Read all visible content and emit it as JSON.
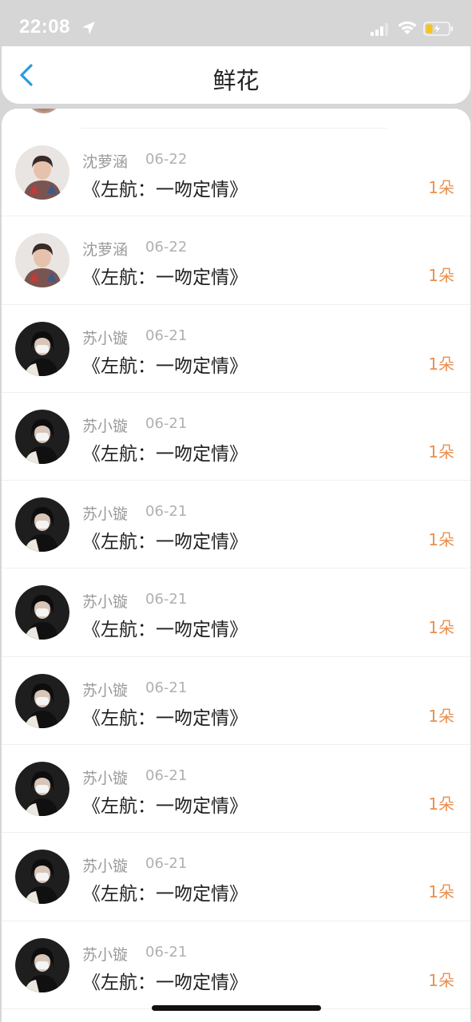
{
  "status_bar": {
    "time": "22:08",
    "icons": [
      "location-arrow-icon",
      "signal-icon",
      "wifi-icon",
      "battery-charging-icon"
    ]
  },
  "header": {
    "title": "鲜花",
    "back_icon": "chevron-left-icon"
  },
  "colors": {
    "accent": "#2a9be0",
    "count": "#e89050",
    "name": "#9b9b9b",
    "date": "#b0b0b0",
    "title": "#1f1f1f"
  },
  "items": [
    {
      "name": "沈萝涵",
      "date": "06-22",
      "title": "《左航：一吻定情》",
      "count": "1朵",
      "avatar": "avatar-a"
    },
    {
      "name": "沈萝涵",
      "date": "06-22",
      "title": "《左航：一吻定情》",
      "count": "1朵",
      "avatar": "avatar-a"
    },
    {
      "name": "苏小镟",
      "date": "06-21",
      "title": "《左航：一吻定情》",
      "count": "1朵",
      "avatar": "avatar-b"
    },
    {
      "name": "苏小镟",
      "date": "06-21",
      "title": "《左航：一吻定情》",
      "count": "1朵",
      "avatar": "avatar-b"
    },
    {
      "name": "苏小镟",
      "date": "06-21",
      "title": "《左航：一吻定情》",
      "count": "1朵",
      "avatar": "avatar-b"
    },
    {
      "name": "苏小镟",
      "date": "06-21",
      "title": "《左航：一吻定情》",
      "count": "1朵",
      "avatar": "avatar-b"
    },
    {
      "name": "苏小镟",
      "date": "06-21",
      "title": "《左航：一吻定情》",
      "count": "1朵",
      "avatar": "avatar-b"
    },
    {
      "name": "苏小镟",
      "date": "06-21",
      "title": "《左航：一吻定情》",
      "count": "1朵",
      "avatar": "avatar-b"
    },
    {
      "name": "苏小镟",
      "date": "06-21",
      "title": "《左航：一吻定情》",
      "count": "1朵",
      "avatar": "avatar-b"
    },
    {
      "name": "苏小镟",
      "date": "06-21",
      "title": "《左航：一吻定情》",
      "count": "1朵",
      "avatar": "avatar-b"
    }
  ]
}
